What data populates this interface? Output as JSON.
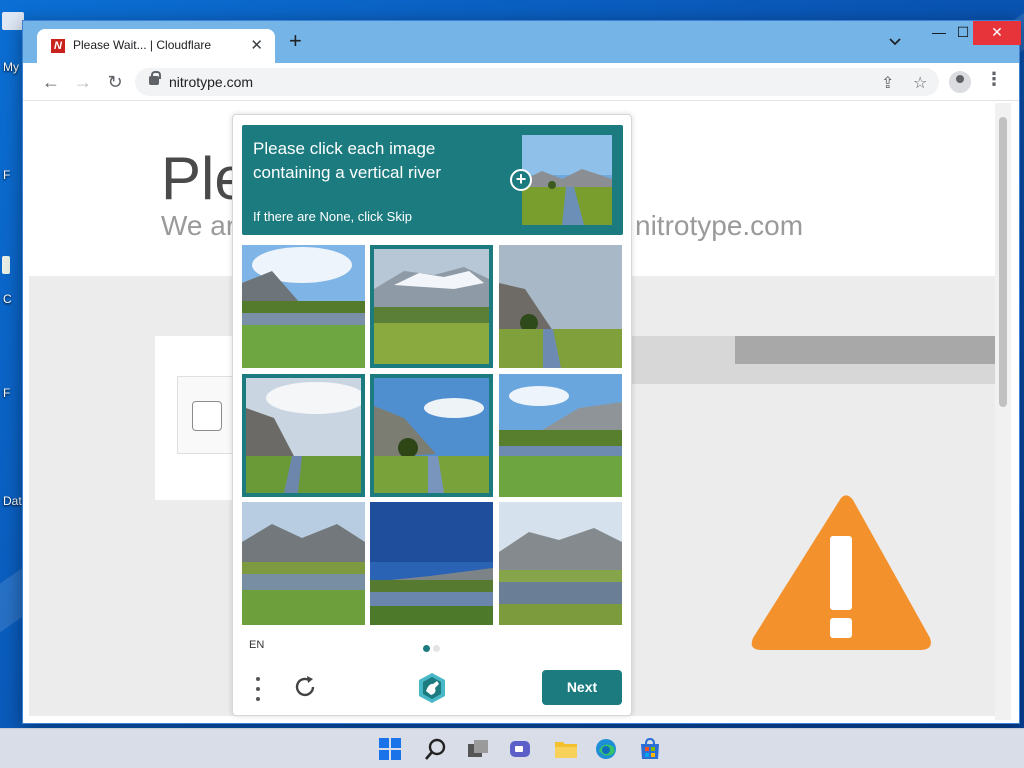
{
  "desktop": {
    "labels": [
      "My",
      "F",
      "C",
      "F",
      "Dat"
    ]
  },
  "browser": {
    "tab": {
      "title": "Please Wait... | Cloudflare",
      "favicon_letter": "N"
    },
    "new_tab": "+",
    "tab_search": "⌄",
    "window_controls": {
      "minimize": "—",
      "maximize": "☐",
      "close": "✕"
    },
    "nav": {
      "back": "←",
      "forward": "→",
      "reload": "↻"
    },
    "url": "nitrotype.com",
    "share_icon": "⇪",
    "star_icon": "☆",
    "menu_icon": "⋮"
  },
  "page": {
    "heading": "Ple",
    "subheading_left": "We ar",
    "subheading_right": "nitrotype.com"
  },
  "captcha": {
    "prompt": "Please click each image containing a vertical river",
    "skip_hint": "If there are None, click Skip",
    "plus_icon": "+",
    "cells": [
      {
        "index": 1,
        "selected": false,
        "scene": "mountain-lake-cloudy"
      },
      {
        "index": 2,
        "selected": true,
        "scene": "snow-mountain-grass"
      },
      {
        "index": 3,
        "selected": false,
        "scene": "vertical-river-cliff"
      },
      {
        "index": 4,
        "selected": true,
        "scene": "vertical-river-cliff-cloudy"
      },
      {
        "index": 5,
        "selected": true,
        "scene": "vertical-river-tree"
      },
      {
        "index": 6,
        "selected": false,
        "scene": "mountain-river-horizontal"
      },
      {
        "index": 7,
        "selected": false,
        "scene": "mountains-lake"
      },
      {
        "index": 8,
        "selected": false,
        "scene": "blue-sky-lake"
      },
      {
        "index": 9,
        "selected": false,
        "scene": "mountain-lake-clear"
      }
    ],
    "language": "EN",
    "next_label": "Next",
    "colors": {
      "accent": "#1b7b7f"
    }
  },
  "warning_icon": "exclamation-triangle",
  "warning_color": "#f3912d"
}
